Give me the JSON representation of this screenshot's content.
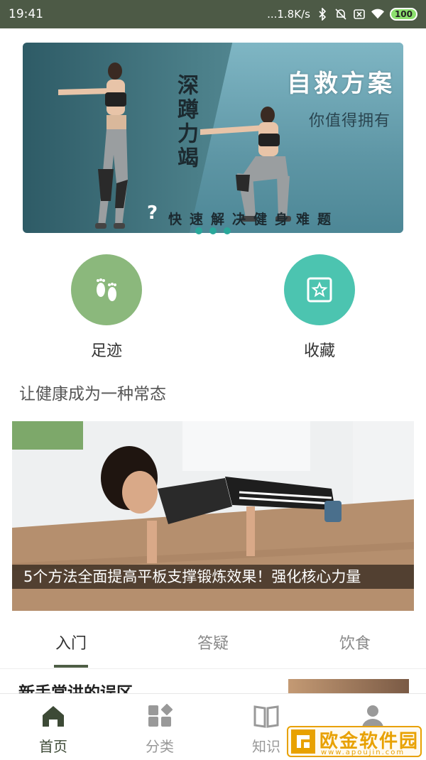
{
  "status_bar": {
    "time": "19:41",
    "network_speed": "...1.8K/s",
    "battery": "100",
    "icons": [
      "bluetooth-icon",
      "alarm-off-icon",
      "sim-off-icon",
      "wifi-icon",
      "battery-icon"
    ]
  },
  "banner": {
    "title": "自救方案",
    "subtitle": "你值得拥有",
    "vertical_text": "深蹲力竭",
    "question_mark": "?",
    "bottom_text": "快速解决健身难题",
    "active_dot": 1,
    "dot_count": 3
  },
  "quick_actions": [
    {
      "label": "足迹",
      "icon": "footprints-icon",
      "color": "#8bb87c"
    },
    {
      "label": "收藏",
      "icon": "star-square-icon",
      "color": "#4cc4b0"
    }
  ],
  "section": {
    "title": "让健康成为一种常态"
  },
  "feature": {
    "caption": "5个方法全面提高平板支撑锻炼效果！强化核心力量"
  },
  "tabs": [
    {
      "label": "入门",
      "active": true
    },
    {
      "label": "答疑",
      "active": false
    },
    {
      "label": "饮食",
      "active": false
    }
  ],
  "list": {
    "first_title": "新手常讲的误区"
  },
  "bottom_nav": [
    {
      "label": "首页",
      "icon": "home-icon",
      "active": true
    },
    {
      "label": "分类",
      "icon": "category-icon",
      "active": false
    },
    {
      "label": "知识",
      "icon": "book-icon",
      "active": false
    },
    {
      "label": "我的",
      "icon": "person-icon",
      "active": false
    }
  ],
  "watermark": {
    "text": "欧金软件园",
    "sub": "www.apoujin.com"
  },
  "colors": {
    "status_bar": "#4d5a46",
    "accent": "#4e5e45",
    "dot": "#2aa79a"
  }
}
